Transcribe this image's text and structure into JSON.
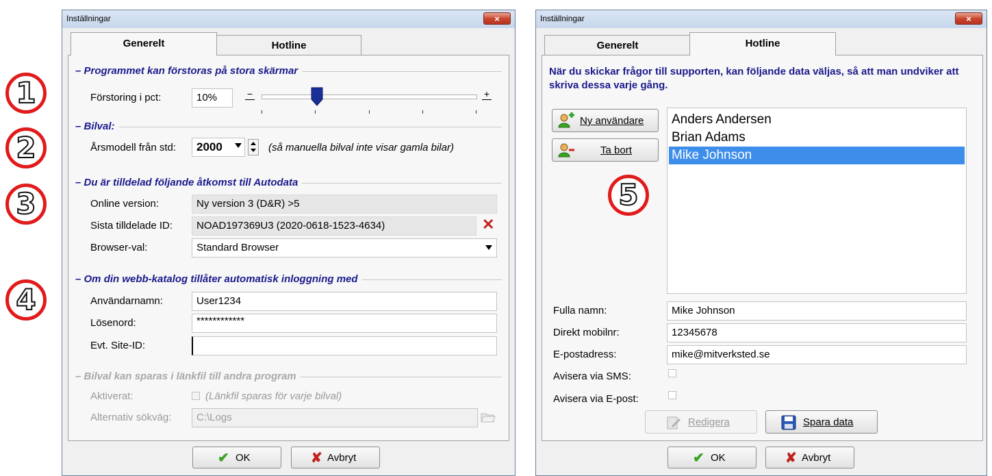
{
  "annotations": [
    "1",
    "2",
    "3",
    "4",
    "5"
  ],
  "left_dialog": {
    "title": "Inställningar",
    "close_label": "×",
    "tabs": [
      "Generelt",
      "Hotline"
    ],
    "section_zoom": {
      "title": "Programmet kan förstoras på stora skärmar",
      "label": "Förstoring i pct:",
      "value": "10%",
      "minus": "−",
      "plus": "+"
    },
    "slider_level": 0.26,
    "section_car": {
      "title": "Bilval:",
      "label": "Årsmodell från std:",
      "year": "2000",
      "note": "(så manuella bilval inte visar gamla bilar)"
    },
    "section_access": {
      "title": "Du är tilldelad följande åtkomst till Autodata",
      "online_label": "Online version:",
      "online_value": "Ny version 3  (D&R) >5",
      "id_label": "Sista tilldelade ID:",
      "id_value": "NOAD197369U3  (2020-0618-1523-4634)",
      "browser_label": "Browser-val:",
      "browser_value": "Standard Browser"
    },
    "section_login": {
      "title": "Om din webb-katalog tillåter automatisk inloggning med",
      "user_label": "Användarnamn:",
      "user_value": "User1234",
      "pass_label": "Lösenord:",
      "pass_value": "************",
      "site_label": "Evt. Site-ID:",
      "site_value": ""
    },
    "section_link": {
      "title": "Bilval kan sparas i länkfil till andra program",
      "active_label": "Aktiverat:",
      "active_note": "(Länkfil sparas för varje bilval)",
      "path_label": "Alternativ sökväg:",
      "path_value": "C:\\Logs"
    },
    "ok_label": "OK",
    "cancel_label": "Avbryt"
  },
  "right_dialog": {
    "title": "Inställningar",
    "close_label": "×",
    "tabs": [
      "Generelt",
      "Hotline"
    ],
    "intro": "När du skickar frågor till supporten, kan följande data väljas, så att man undviker att skriva dessa varje gång.",
    "new_user_button": "Ny användare",
    "remove_button": "Ta bort",
    "users": [
      "Anders Andersen",
      "Brian Adams",
      "Mike Johnson"
    ],
    "selected_user": "Mike Johnson",
    "name_label": "Fulla namn:",
    "name_value": "Mike Johnson",
    "mobile_label": "Direkt mobilnr:",
    "mobile_value": "12345678",
    "email_label": "E-postadress:",
    "email_value": "mike@mitverksted.se",
    "sms_label": "Avisera via SMS:",
    "mail_label": "Avisera via E-post:",
    "edit_button": "Redigera",
    "save_button": "Spara data",
    "ok_label": "OK",
    "cancel_label": "Avbryt"
  },
  "colors": {
    "section_title": "#1a1a8c",
    "annotation_ring": "#e11b1b",
    "selection": "#3d8eea",
    "ok_check": "#3aa321",
    "cancel_x": "#c0231e"
  }
}
